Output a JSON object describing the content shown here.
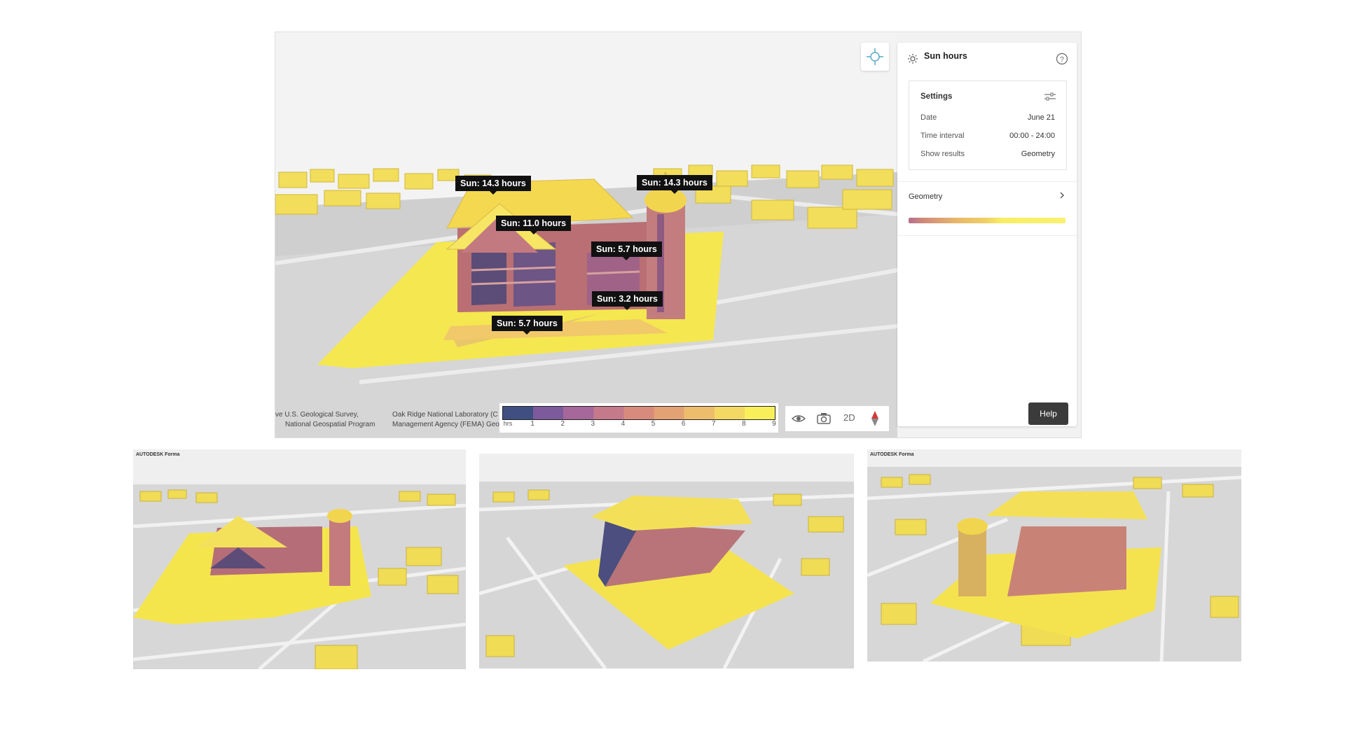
{
  "panel": {
    "title": "Sun hours",
    "settings_label": "Settings",
    "rows": [
      {
        "label": "Date",
        "value": "June 21"
      },
      {
        "label": "Time interval",
        "value": "00:00 - 24:00"
      },
      {
        "label": "Show results",
        "value": "Geometry"
      }
    ],
    "geometry_label": "Geometry",
    "help_label": "Help"
  },
  "tags": [
    "Sun: 14.3 hours",
    "Sun: 14.3 hours",
    "Sun: 11.0 hours",
    "Sun: 5.7 hours",
    "Sun: 3.2 hours",
    "Sun: 5.7 hours"
  ],
  "legend": {
    "unit": "hrs",
    "ticks": [
      "1",
      "2",
      "3",
      "4",
      "5",
      "6",
      "7",
      "8",
      "9"
    ],
    "colors": [
      "#3f4f82",
      "#7c5a9b",
      "#a6679a",
      "#c47a8a",
      "#d88b7c",
      "#e3a274",
      "#edbd6c",
      "#f4d864",
      "#f9ef5a"
    ]
  },
  "toolbar": {
    "view2d_label": "2D"
  },
  "attribution": {
    "line1a": "ve U.S. Geological Survey,",
    "line1b": "National Geospatial Program",
    "line2a": "Oak Ridge National Laboratory (C",
    "line2b": "Management Agency (FEMA) Geo"
  },
  "thumbnails": {
    "brand": "AUTODESK Forma"
  }
}
